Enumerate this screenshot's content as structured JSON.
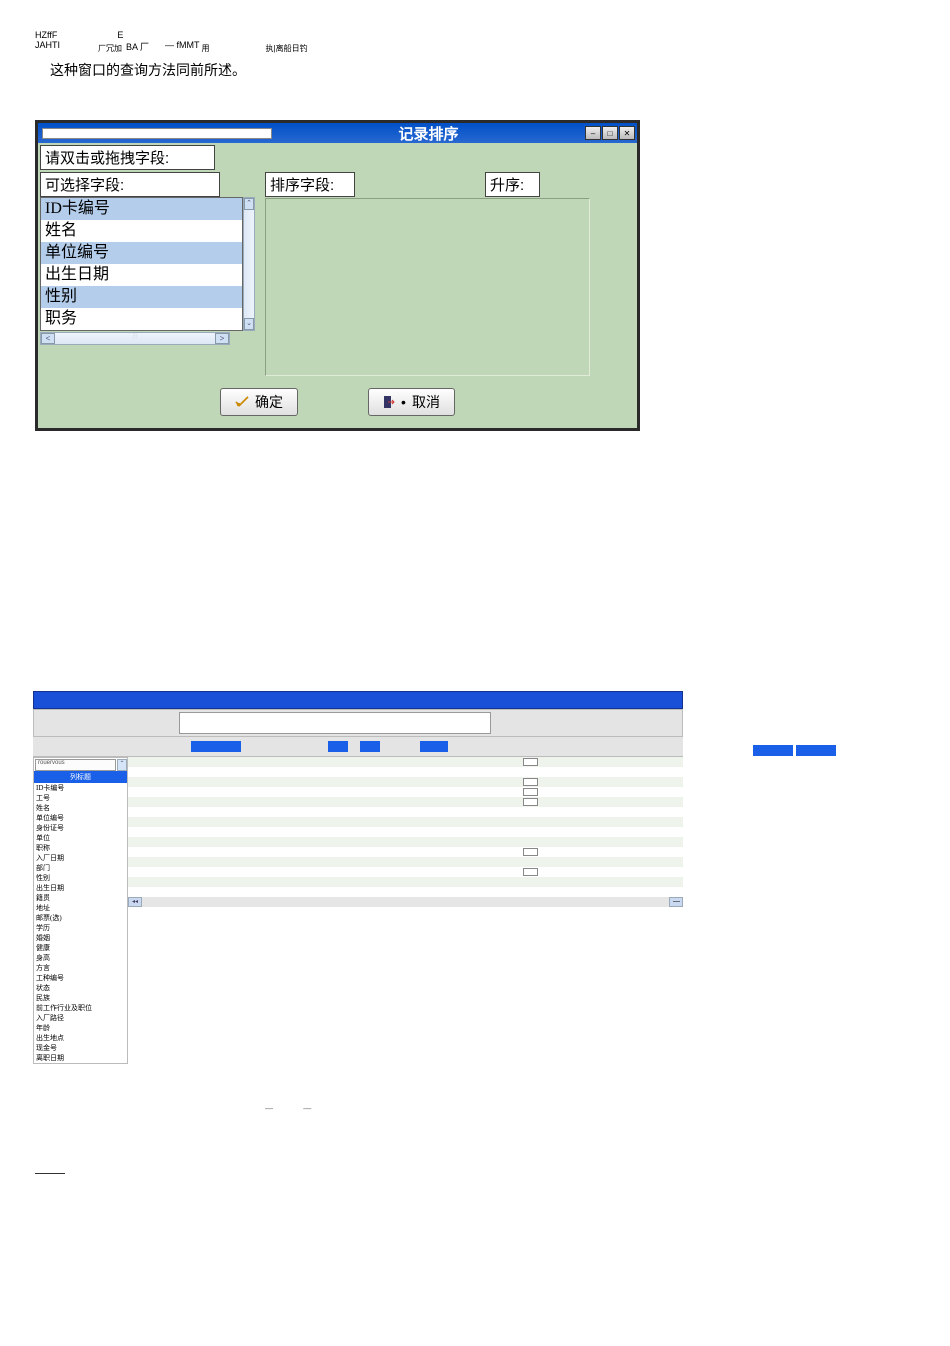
{
  "top": {
    "l1a": "HZffF",
    "l1b": "E",
    "l2a": "JAHTI",
    "l2b": "厂冗加",
    "l2c": "BA 厂",
    "l2d": "— fMMT",
    "l2e": "用",
    "l2f": "执|离船日钓",
    "caption": "这种窗口的查询方法同前所述。"
  },
  "dialog1": {
    "title": "记录排序",
    "instr": "请双击或拖拽字段:",
    "col1_label": "可选择字段:",
    "col2_label": "排序字段:",
    "col3_label": "升序:",
    "items": [
      "ID卡编号",
      "姓名",
      "单位编号",
      "出生日期",
      "性别",
      "职务"
    ],
    "ok": "确定",
    "cancel": "取消"
  },
  "win2": {
    "side_search": "rouervous",
    "side_header": "列标题",
    "side_items": [
      "ID卡编号",
      "工号",
      "姓名",
      "单位编号",
      "身份证号",
      "单位",
      "职称",
      "入厂日期",
      "部门",
      "性别",
      "出生日期",
      "籍贯",
      "地址",
      "邮票(选)",
      "学历",
      "婚姻",
      "健康",
      "身高",
      "方言",
      "工种编号",
      "状态",
      "民族",
      "前工作行业及职位",
      "入厂路径",
      "年龄",
      "出生地点",
      "现金号",
      "离职日期"
    ],
    "dashes": "— —"
  }
}
